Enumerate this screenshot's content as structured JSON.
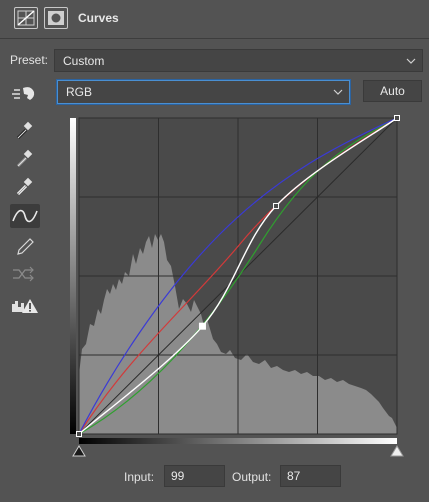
{
  "header": {
    "title": "Curves",
    "icons": [
      "adjustment-layer-icon",
      "layer-mask-icon"
    ]
  },
  "preset": {
    "label": "Preset:",
    "value": "Custom"
  },
  "channel": {
    "value": "RGB"
  },
  "auto_button": {
    "label": "Auto"
  },
  "tools": [
    "target-adjustment-icon",
    "black-point-eyedropper-icon",
    "gray-point-eyedropper-icon",
    "white-point-eyedropper-icon",
    "curve-edit-icon",
    "pencil-draw-icon",
    "smooth-curve-icon",
    "clipping-warning-icon"
  ],
  "curves": {
    "rgb_points": [
      [
        0,
        0
      ],
      [
        99,
        87
      ],
      [
        158,
        184
      ],
      [
        255,
        255
      ]
    ],
    "colors": {
      "rgb": "#ffffff",
      "red": "#d23a3a",
      "green": "#2fa02f",
      "blue": "#3a3ad6",
      "baseline": "#2a2a2a"
    }
  },
  "io": {
    "input_label": "Input:",
    "input_value": "99",
    "output_label": "Output:",
    "output_value": "87"
  }
}
